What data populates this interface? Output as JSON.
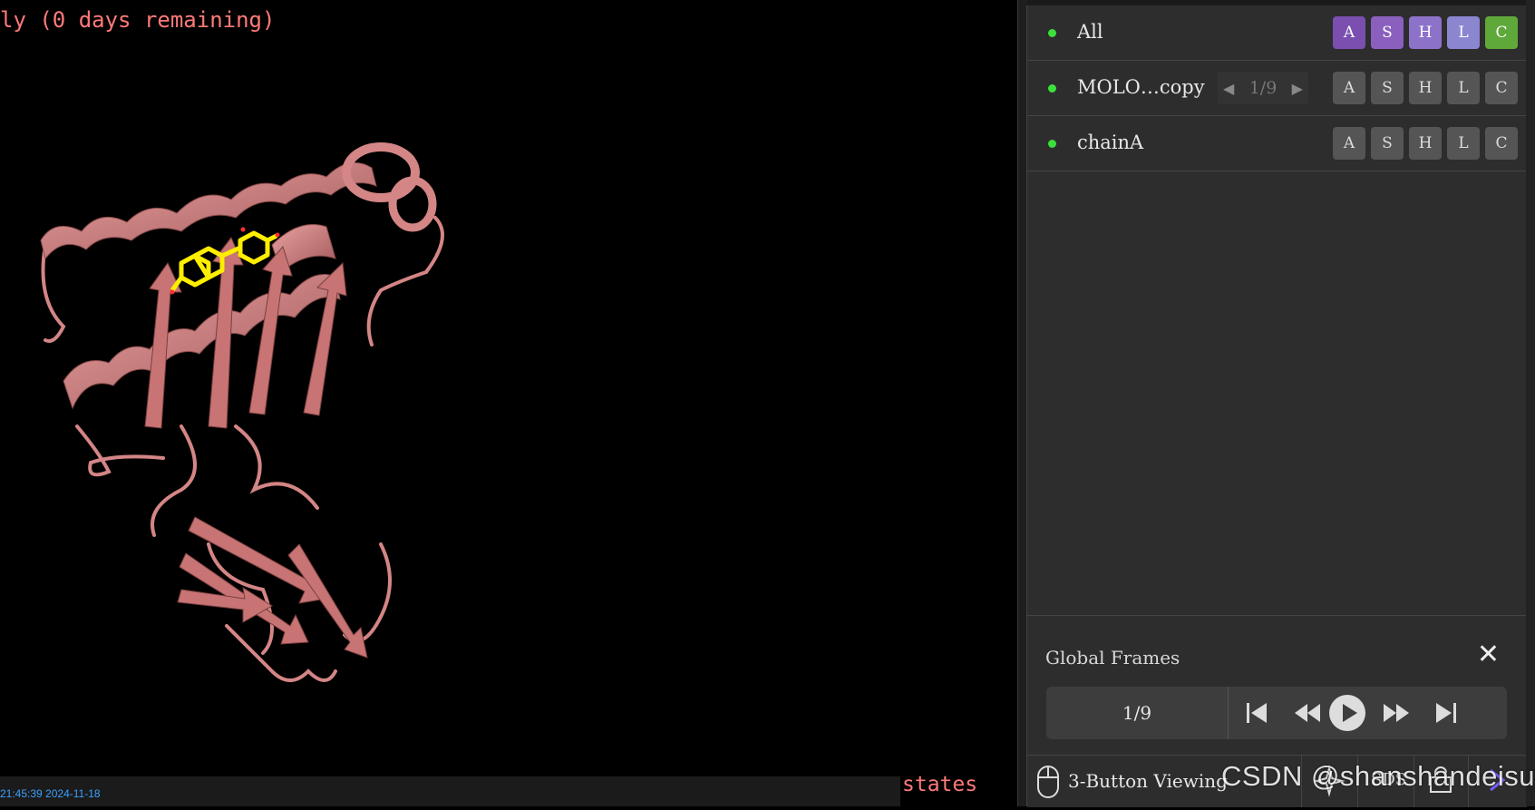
{
  "viewport": {
    "license_text": "ly (0 days remaining)",
    "timestamp": "21:45:39 2024-11-18",
    "states_label": "states",
    "ribbon_color": "#d98080",
    "ligand_color": "#ffee00"
  },
  "objects": [
    {
      "name": "All",
      "enabled": true,
      "buttons": [
        "A",
        "S",
        "H",
        "L",
        "C"
      ]
    },
    {
      "name": "MOLO…copy",
      "enabled": true,
      "stepper": "1/9",
      "buttons": [
        "A",
        "S",
        "H",
        "L",
        "C"
      ]
    },
    {
      "name": "chainA",
      "enabled": true,
      "buttons": [
        "A",
        "S",
        "H",
        "L",
        "C"
      ]
    }
  ],
  "global_frames": {
    "title": "Global Frames",
    "current": "1/9"
  },
  "bottom_bar": {
    "mouse_mode": "3-Button Viewing",
    "extra_label": "SDS"
  },
  "watermark": "CSDN @shanshandeisu",
  "colors": {
    "panel_bg": "#2d2d2d",
    "enabled_dot": "#3be03b",
    "btn_A": "#7a4fb0",
    "btn_C": "#5fa83a"
  }
}
